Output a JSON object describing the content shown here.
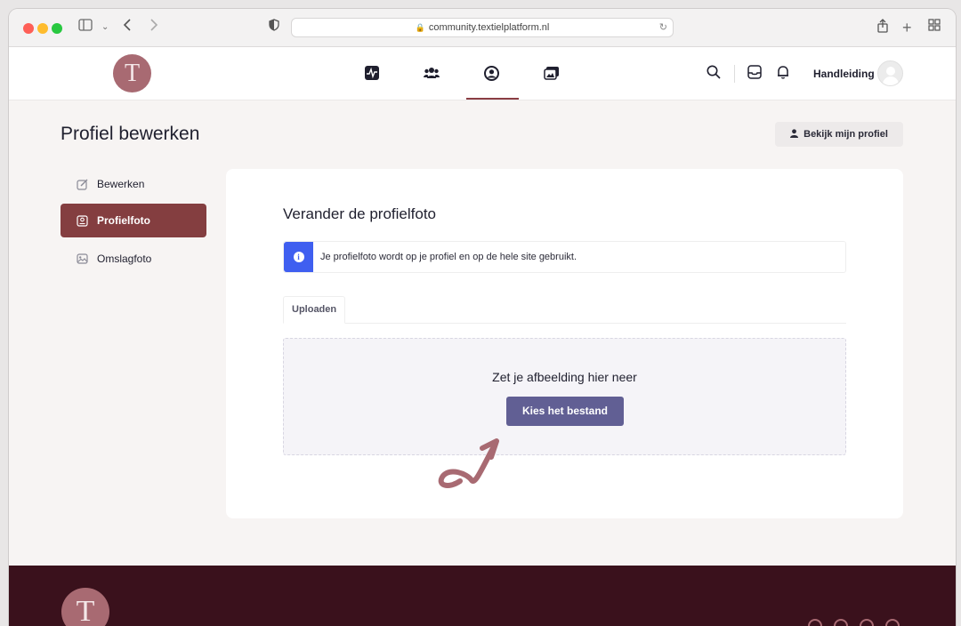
{
  "browser": {
    "url": "community.textielplatform.nl"
  },
  "header": {
    "logo_letter": "T",
    "nav_items": [
      {
        "name": "activity-icon"
      },
      {
        "name": "members-icon"
      },
      {
        "name": "profile-icon"
      },
      {
        "name": "photos-icon"
      }
    ],
    "active_nav": "profile-icon",
    "manual_label": "Handleiding"
  },
  "page": {
    "title": "Profiel bewerken",
    "view_profile_label": "Bekijk mijn profiel"
  },
  "sidebar": {
    "items": [
      {
        "label": "Bewerken",
        "icon": "edit-icon",
        "active": false
      },
      {
        "label": "Profielfoto",
        "icon": "portrait-icon",
        "active": true
      },
      {
        "label": "Omslagfoto",
        "icon": "image-icon",
        "active": false
      }
    ]
  },
  "panel": {
    "title": "Verander de profielfoto",
    "info_text": "Je profielfoto wordt op je profiel en op de hele site gebruikt.",
    "tab_label": "Uploaden",
    "drop_text": "Zet je afbeelding hier neer",
    "choose_button_label": "Kies het bestand"
  },
  "footer": {
    "logo_letter": "T"
  },
  "colors": {
    "brand": "#843e40",
    "button": "#615f94",
    "info": "#3f5ff0",
    "footer": "#3a111c"
  }
}
